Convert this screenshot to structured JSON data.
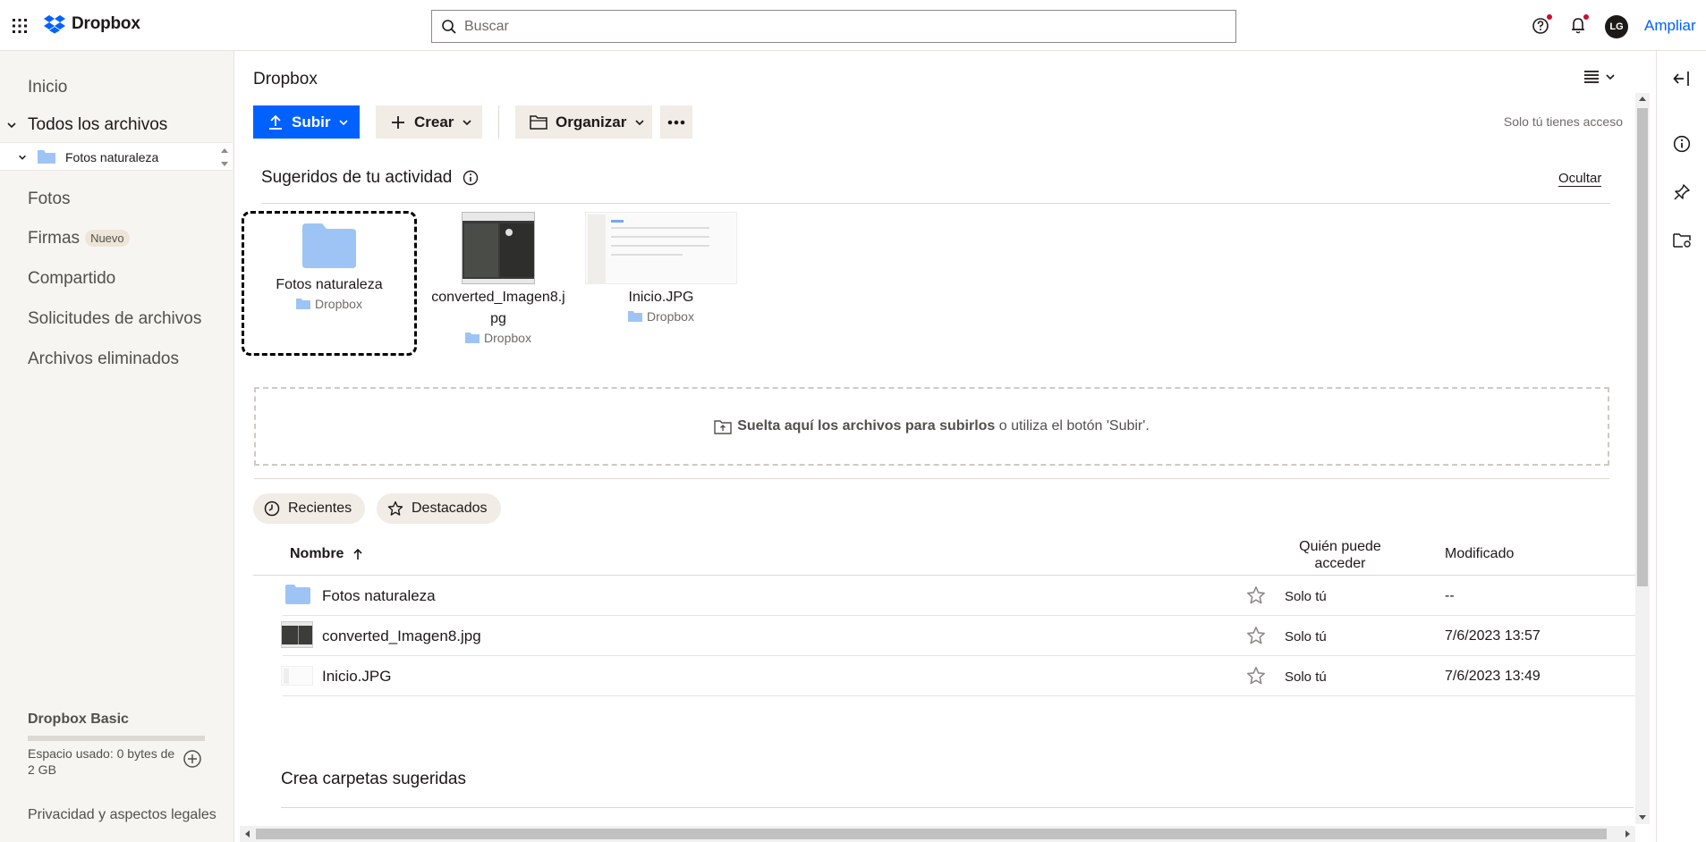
{
  "topbar": {
    "logo_text": "Dropbox",
    "search_placeholder": "Buscar",
    "avatar_initials": "LG",
    "upgrade_label": "Ampliar"
  },
  "sidebar": {
    "items": [
      {
        "label": "Inicio"
      },
      {
        "label": "Todos los archivos"
      },
      {
        "label": "Fotos naturaleza"
      },
      {
        "label": "Fotos"
      },
      {
        "label": "Firmas",
        "badge": "Nuevo"
      },
      {
        "label": "Compartido"
      },
      {
        "label": "Solicitudes de archivos"
      },
      {
        "label": "Archivos eliminados"
      }
    ],
    "plan_name": "Dropbox Basic",
    "usage_text": "Espacio usado: 0 bytes de 2 GB",
    "usage_fraction": 0,
    "privacy_label": "Privacidad y aspectos legales"
  },
  "main": {
    "title": "Dropbox",
    "toolbar": {
      "upload_label": "Subir",
      "create_label": "Crear",
      "organize_label": "Organizar",
      "access_note": "Solo tú tienes acceso"
    },
    "suggested": {
      "title": "Sugeridos de tu actividad",
      "hide_label": "Ocultar",
      "cards": [
        {
          "name": "Fotos naturaleza",
          "location": "Dropbox"
        },
        {
          "name_line1": "converted_Imagen8.j",
          "name_line2": "pg",
          "location": "Dropbox"
        },
        {
          "name": "Inicio.JPG",
          "location": "Dropbox"
        }
      ]
    },
    "dropzone": {
      "bold_text": "Suelta aquí los archivos para subirlos",
      "rest_text": " o utiliza el botón 'Subir'."
    },
    "filters": {
      "recent_label": "Recientes",
      "starred_label": "Destacados"
    },
    "table": {
      "col_name": "Nombre",
      "col_access_line1": "Quién puede",
      "col_access_line2": "acceder",
      "col_modified": "Modificado",
      "rows": [
        {
          "name": "Fotos naturaleza",
          "access": "Solo tú",
          "modified": "--"
        },
        {
          "name": "converted_Imagen8.jpg",
          "access": "Solo tú",
          "modified": "7/6/2023 13:57"
        },
        {
          "name": "Inicio.JPG",
          "access": "Solo tú",
          "modified": "7/6/2023 13:49"
        }
      ]
    },
    "suggested_folders_title": "Crea carpetas sugeridas"
  },
  "colors": {
    "accent": "#0061fe",
    "sidebar_bg": "#f7f5f2",
    "chip_bg": "#f1ece6",
    "folder": "#9ec4f5",
    "notification_dot": "#c8102e"
  }
}
